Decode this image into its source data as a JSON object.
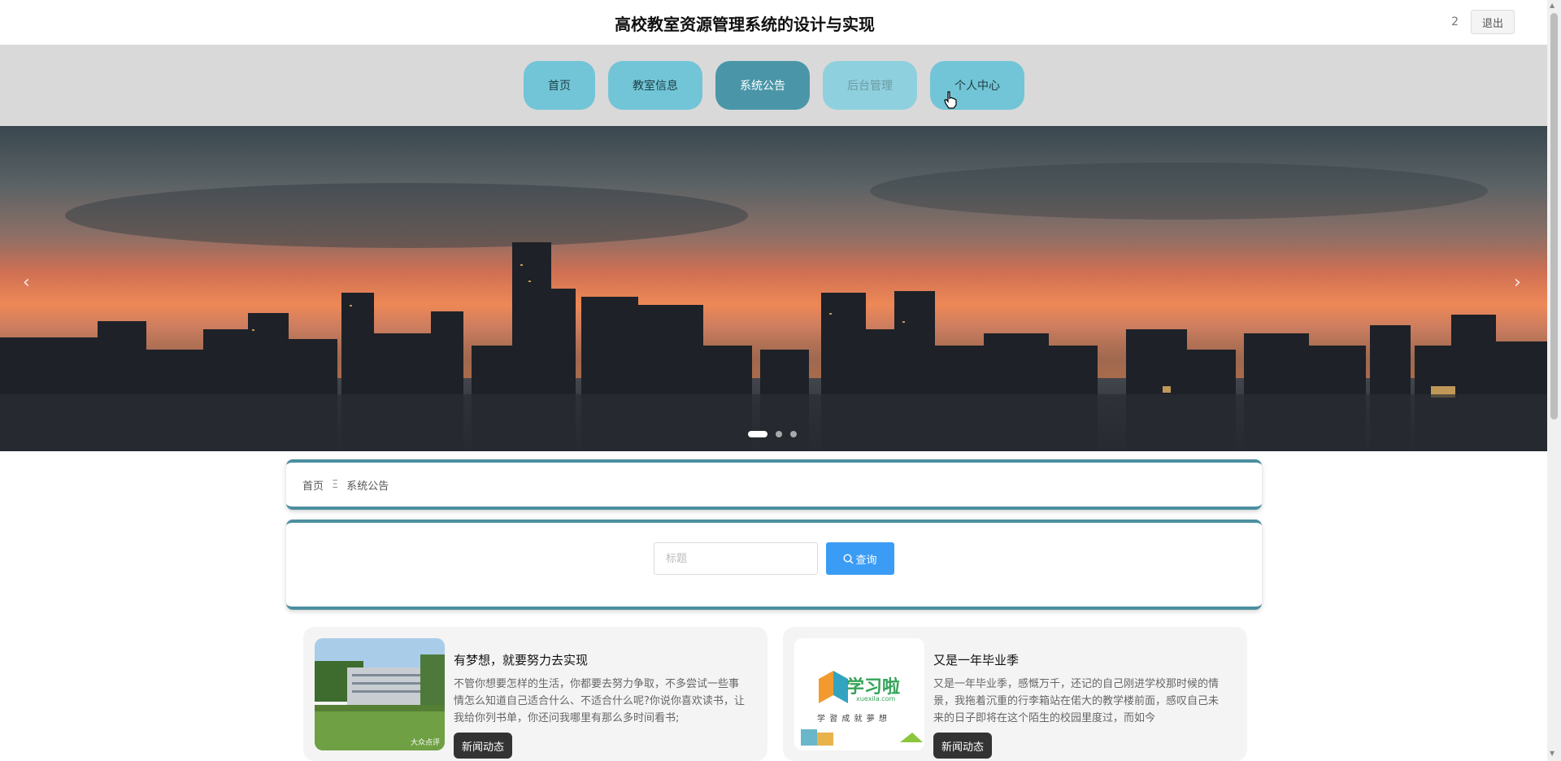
{
  "header": {
    "title": "高校教室资源管理系统的设计与实现",
    "username": "2",
    "logout_label": "退出"
  },
  "nav": {
    "items": [
      {
        "label": "首页"
      },
      {
        "label": "教室信息"
      },
      {
        "label": "系统公告"
      },
      {
        "label": "后台管理"
      },
      {
        "label": "个人中心"
      }
    ],
    "active": "系统公告"
  },
  "banner": {
    "prev": "‹",
    "next": "›",
    "slide_count": 3,
    "active_slide": 1
  },
  "breadcrumb": {
    "home": "首页",
    "separator": "Ξ",
    "current": "系统公告"
  },
  "search": {
    "placeholder": "标题",
    "value": "",
    "button_label": "查询"
  },
  "news": [
    {
      "title": "有梦想，就要努力去实现",
      "excerpt": "不管你想要怎样的生活，你都要去努力争取，不多尝试一些事情怎么知道自己适合什么、不适合什么呢?你说你喜欢读书，让我给你列书单，你还问我哪里有那么多时间看书;",
      "tag": "新闻动态",
      "image_watermark": "大众点评"
    },
    {
      "title": "又是一年毕业季",
      "excerpt": "又是一年毕业季，感慨万千，还记的自己刚进学校那时候的情景，我拖着沉重的行李箱站在偌大的教学楼前面，感叹自己未来的日子即将在这个陌生的校园里度过，而如今",
      "tag": "新闻动态",
      "image_logo": "学习啦",
      "image_logo_sub": "xuexila.com",
      "image_slogan": "学 習 成 就 夢 想"
    }
  ],
  "colors": {
    "nav": "#72c5d6",
    "nav_active": "#4a96a8",
    "accent": "#4b8fa0",
    "search_button": "#3b9cf5"
  }
}
